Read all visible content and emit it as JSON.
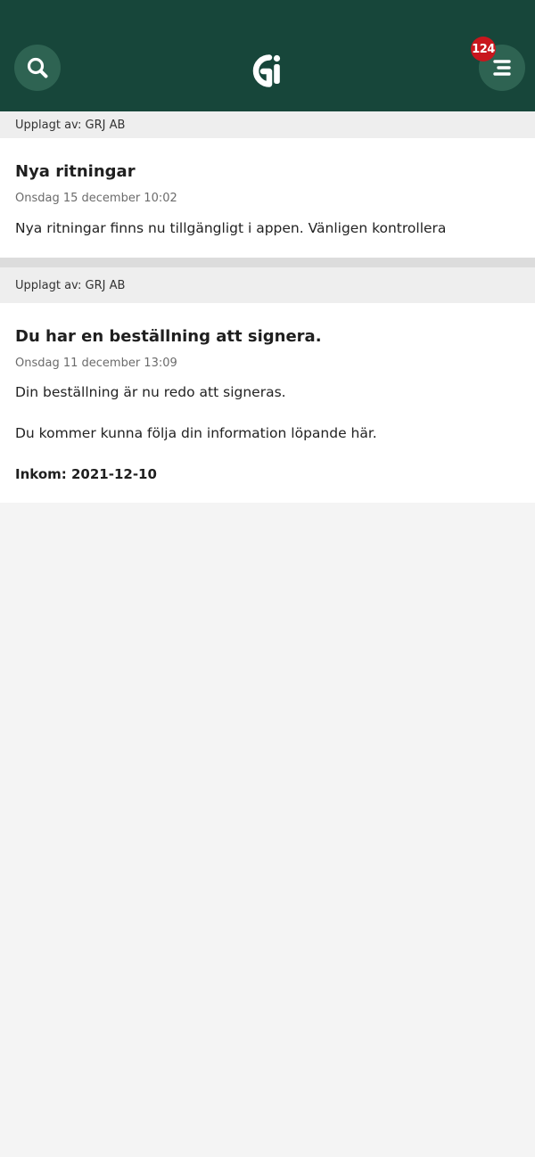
{
  "header": {
    "search_icon": "search-icon",
    "logo_text": "Gi",
    "menu_icon": "menu-icon",
    "notification_count": "124",
    "colors": {
      "background": "#17463a",
      "button": "#2e6352",
      "badge": "#c8161d"
    }
  },
  "posts": [
    {
      "posted_by": "Upplagt av: GRJ AB",
      "title": "Nya ritningar",
      "date": "Onsdag 15 december 10:02",
      "body": "Nya ritningar finns nu tillgängligt i appen. Vänligen kontrollera"
    },
    {
      "posted_by": "Upplagt av: GRJ AB",
      "title": "Du har en beställning att signera.",
      "date": "Onsdag 11 december 13:09",
      "body_1": "Din beställning är nu redo att signeras.",
      "body_2": "Du kommer kunna följa din information löpande här.",
      "footer": "Inkom: 2021-12-10"
    }
  ]
}
